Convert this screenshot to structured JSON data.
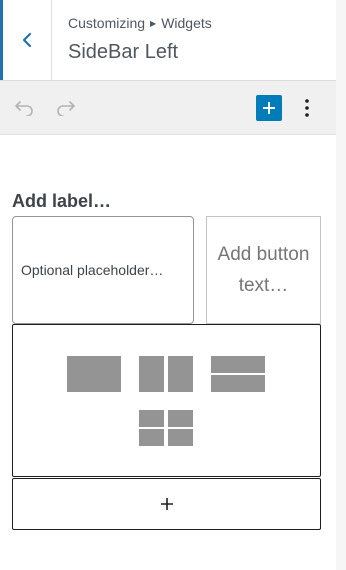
{
  "header": {
    "breadcrumb": [
      "Customizing",
      "Widgets"
    ],
    "title": "SideBar Left",
    "back_icon": "chevron-left-icon",
    "accent_color": "#2271b1"
  },
  "toolbar": {
    "undo_icon": "undo-icon",
    "redo_icon": "redo-icon",
    "inserter_icon": "plus-icon",
    "inserter_color": "#007cba",
    "options_icon": "more-vertical-icon"
  },
  "search_block": {
    "label": "Add label…",
    "placeholder": "Optional placeholder…",
    "button_text": "Add button text…"
  },
  "layout_picker": {
    "options": [
      "one-column-layout",
      "two-column-layout",
      "two-row-layout",
      "grid-layout"
    ]
  },
  "appender": {
    "icon": "plus-icon"
  }
}
